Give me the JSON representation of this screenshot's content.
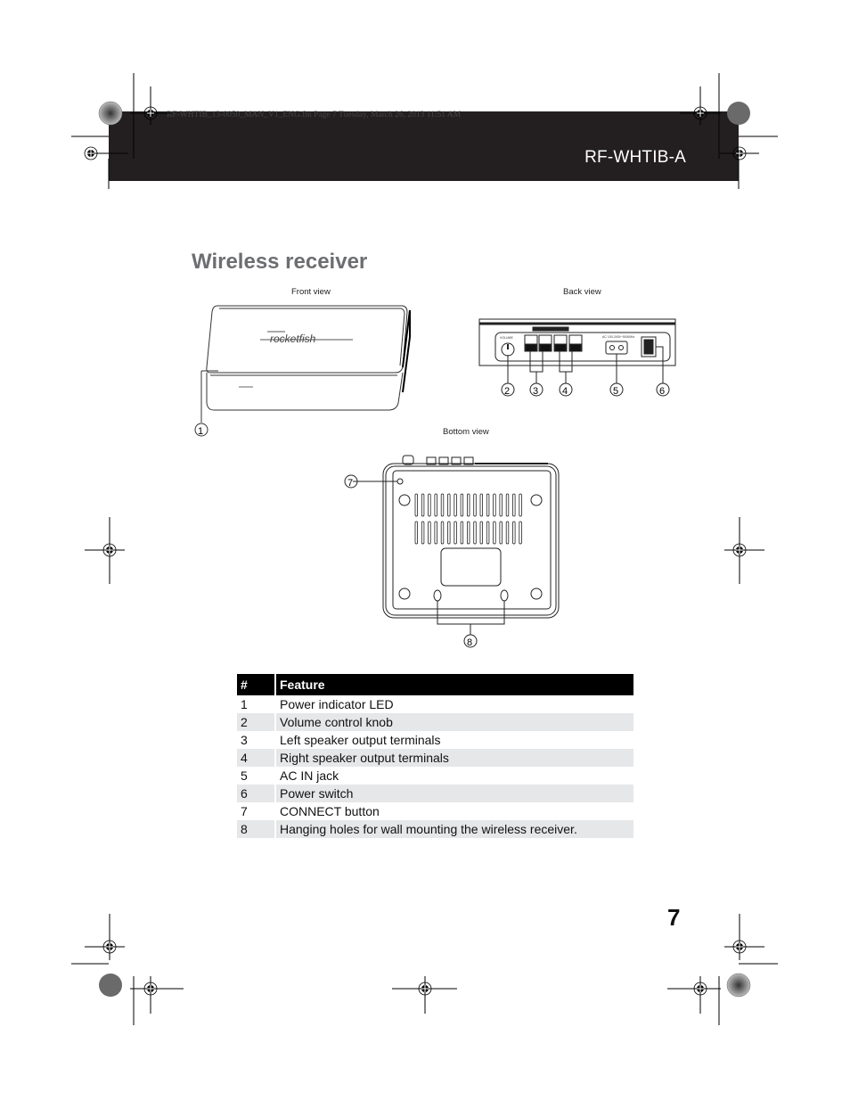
{
  "header": {
    "file_meta": "RF-WHTIB_13-0050_MAN_V1_ENG.fm  Page 7  Tuesday, March 26, 2013  11:51 AM",
    "model": "RF-WHTIB-A"
  },
  "section": {
    "title": "Wireless receiver"
  },
  "figures": {
    "front": {
      "caption": "Front view",
      "brand": "rocketfish",
      "callouts": [
        "1"
      ]
    },
    "back": {
      "caption": "Back view",
      "knob_label": "VOLUME",
      "ac_label": "AC 100-240V~50/60Hz",
      "callouts": [
        "2",
        "3",
        "4",
        "5",
        "6"
      ]
    },
    "bottom": {
      "caption": "Bottom view",
      "callouts": [
        "7",
        "8"
      ]
    }
  },
  "table": {
    "headers": [
      "#",
      "Feature"
    ],
    "rows": [
      {
        "num": "1",
        "feature": "Power indicator LED"
      },
      {
        "num": "2",
        "feature": "Volume control knob"
      },
      {
        "num": "3",
        "feature": "Left speaker output terminals"
      },
      {
        "num": "4",
        "feature": "Right speaker output terminals"
      },
      {
        "num": "5",
        "feature": "AC IN jack"
      },
      {
        "num": "6",
        "feature": "Power switch"
      },
      {
        "num": "7",
        "feature": "CONNECT button"
      },
      {
        "num": "8",
        "feature": "Hanging holes for wall mounting the wireless receiver."
      }
    ]
  },
  "footer": {
    "page_number": "7"
  }
}
